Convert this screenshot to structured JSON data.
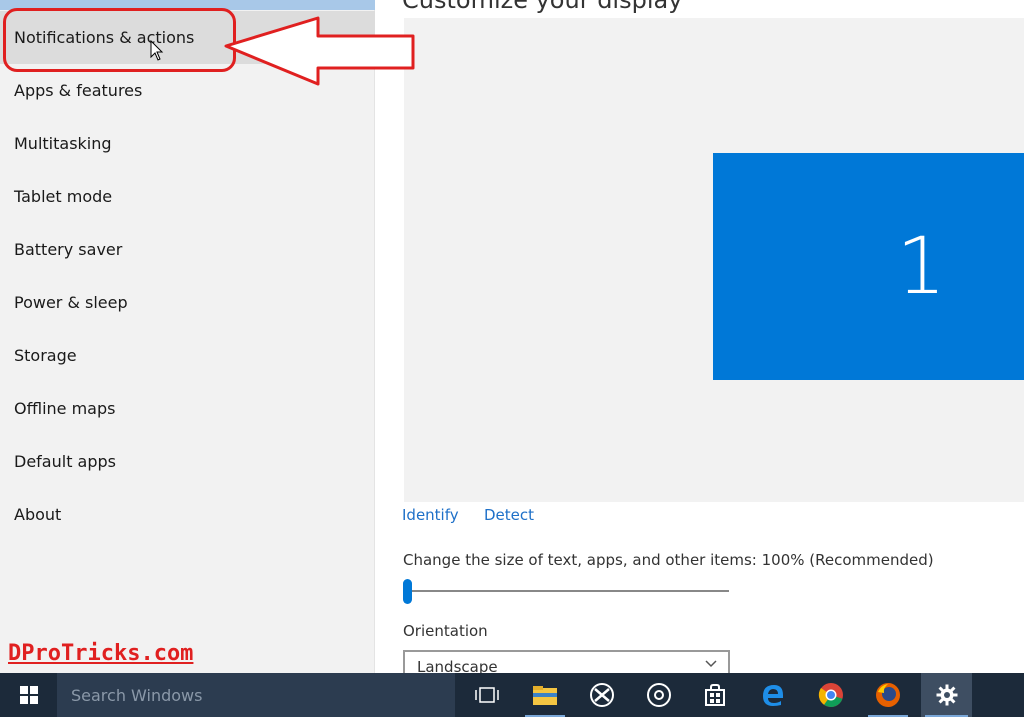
{
  "sidebar": {
    "items": [
      {
        "label": "Notifications & actions",
        "selected": true
      },
      {
        "label": "Apps & features"
      },
      {
        "label": "Multitasking"
      },
      {
        "label": "Tablet mode"
      },
      {
        "label": "Battery saver"
      },
      {
        "label": "Power & sleep"
      },
      {
        "label": "Storage"
      },
      {
        "label": "Offline maps"
      },
      {
        "label": "Default apps"
      },
      {
        "label": "About"
      }
    ]
  },
  "main": {
    "title": "Customize your display",
    "monitor_number": "1",
    "identify_label": "Identify",
    "detect_label": "Detect",
    "size_label": "Change the size of text, apps, and other items: 100% (Recommended)",
    "size_value_percent": 100,
    "orientation_label": "Orientation",
    "orientation_value": "Landscape"
  },
  "watermark": "DProTricks.com",
  "taskbar": {
    "search_placeholder": "Search Windows",
    "icons": [
      "task-view-icon",
      "file-explorer-icon",
      "xbox-icon",
      "groove-music-icon",
      "store-icon",
      "edge-icon",
      "chrome-icon",
      "firefox-icon",
      "settings-icon"
    ]
  },
  "colors": {
    "accent": "#0078d7",
    "annotation": "#e02020",
    "taskbar": "#1c2a3a"
  }
}
